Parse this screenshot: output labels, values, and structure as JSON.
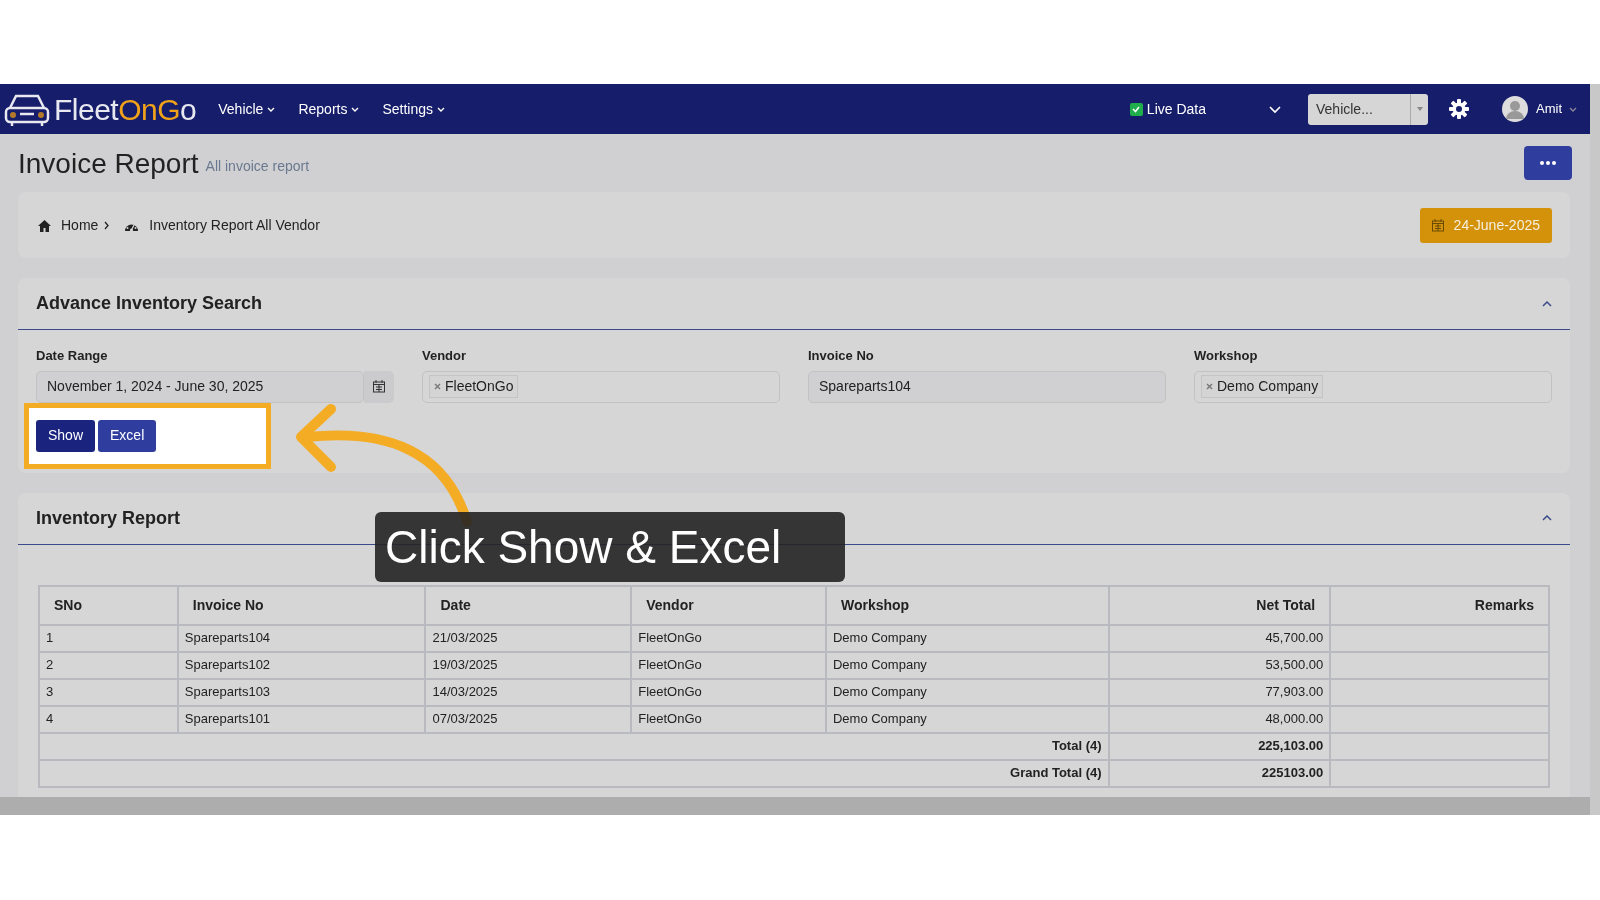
{
  "navbar": {
    "brand": [
      {
        "text": "Fleet",
        "accent": false
      },
      {
        "text": "OnG",
        "accent": true
      },
      {
        "text": "o",
        "accent": false
      }
    ],
    "menus": [
      {
        "label": "Vehicle"
      },
      {
        "label": "Reports"
      },
      {
        "label": "Settings"
      }
    ],
    "live_data": {
      "label": "Live Data",
      "checked": true
    },
    "vehicle_select": {
      "placeholder": "Vehicle..."
    },
    "user": {
      "name": "Amit"
    }
  },
  "page_header": {
    "title": "Invoice Report",
    "subtitle": "All invoice report"
  },
  "breadcrumb": {
    "items": [
      {
        "label": "Home",
        "kind": "home"
      },
      {
        "label": "Inventory Report All Vendor",
        "kind": "current"
      }
    ],
    "date": "24-June-2025"
  },
  "search_panel": {
    "title": "Advance Inventory Search",
    "expanded": true,
    "fields": [
      {
        "label": "Date Range",
        "kind": "date",
        "value": "November 1, 2024 - June 30, 2025"
      },
      {
        "label": "Vendor",
        "kind": "tags",
        "tags": [
          "FleetOnGo"
        ]
      },
      {
        "label": "Invoice No",
        "kind": "text",
        "value": "Spareparts104"
      },
      {
        "label": "Workshop",
        "kind": "tags",
        "tags": [
          "Demo Company"
        ]
      }
    ],
    "buttons": [
      "Show",
      "Excel"
    ]
  },
  "report_panel": {
    "title": "Inventory Report",
    "expanded": true,
    "table": {
      "columns": [
        {
          "label": "SNo"
        },
        {
          "label": "Invoice No"
        },
        {
          "label": "Date"
        },
        {
          "label": "Vendor"
        },
        {
          "label": "Workshop"
        },
        {
          "label": "Net Total"
        },
        {
          "label": "Remarks"
        }
      ],
      "rows": [
        [
          "1",
          "Spareparts104",
          "21/03/2025",
          "FleetOnGo",
          "Demo Company",
          "45,700.00"
        ],
        [
          "2",
          "Spareparts102",
          "19/03/2025",
          "FleetOnGo",
          "Demo Company",
          "53,500.00"
        ],
        [
          "3",
          "Spareparts103",
          "14/03/2025",
          "FleetOnGo",
          "Demo Company",
          "77,903.00"
        ],
        [
          "4",
          "Spareparts101",
          "07/03/2025",
          "FleetOnGo",
          "Demo Company",
          "48,000.00"
        ]
      ],
      "totals": [
        {
          "label": "Total (4)",
          "value": "225,103.00"
        },
        {
          "label": "Grand Total (4)",
          "value": "225103.00"
        }
      ]
    }
  },
  "callout": {
    "text": "Click Show & Excel"
  }
}
